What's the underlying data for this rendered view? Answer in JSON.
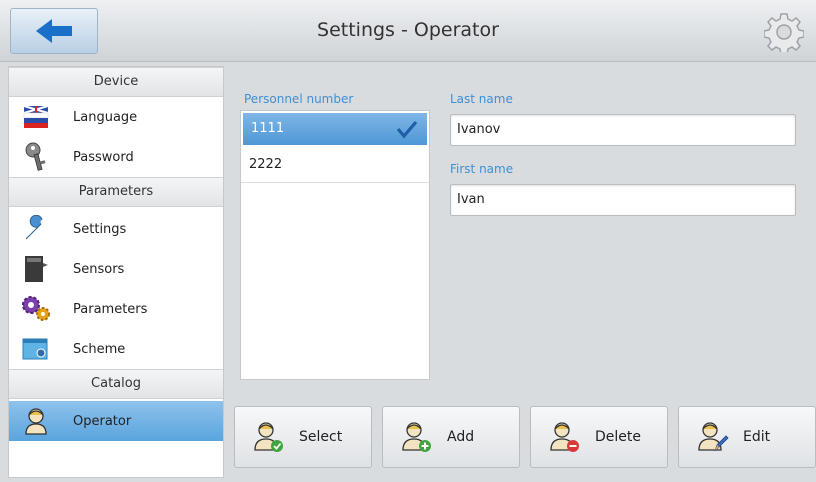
{
  "header": {
    "title": "Settings - Operator",
    "back_icon": "arrow-left-icon",
    "settings_icon": "gear-icon"
  },
  "sidebar": {
    "sections": [
      {
        "title": "Device"
      },
      {
        "title": "Parameters"
      },
      {
        "title": "Catalog"
      }
    ],
    "items": [
      {
        "label": "Language",
        "icon": "flag-icon",
        "active": false
      },
      {
        "label": "Password",
        "icon": "key-icon",
        "active": false
      },
      {
        "label": "Settings",
        "icon": "wrench-icon",
        "active": false
      },
      {
        "label": "Sensors",
        "icon": "sensor-icon",
        "active": false
      },
      {
        "label": "Parameters",
        "icon": "gears-icon",
        "active": false
      },
      {
        "label": "Scheme",
        "icon": "scheme-icon",
        "active": false
      },
      {
        "label": "Operator",
        "icon": "operator-icon",
        "active": true
      }
    ]
  },
  "main": {
    "personnel_label": "Personnel number",
    "personnel": [
      {
        "number": "1111",
        "selected": true
      },
      {
        "number": "2222",
        "selected": false
      }
    ],
    "last_name_label": "Last name",
    "last_name_value": "Ivanov",
    "first_name_label": "First name",
    "first_name_value": "Ivan"
  },
  "actions": {
    "select": "Select",
    "add": "Add",
    "delete": "Delete",
    "edit": "Edit"
  },
  "colors": {
    "accent": "#3f8fd4",
    "active_item": "#5aa4dd",
    "back_arrow": "#1a6fc9"
  }
}
